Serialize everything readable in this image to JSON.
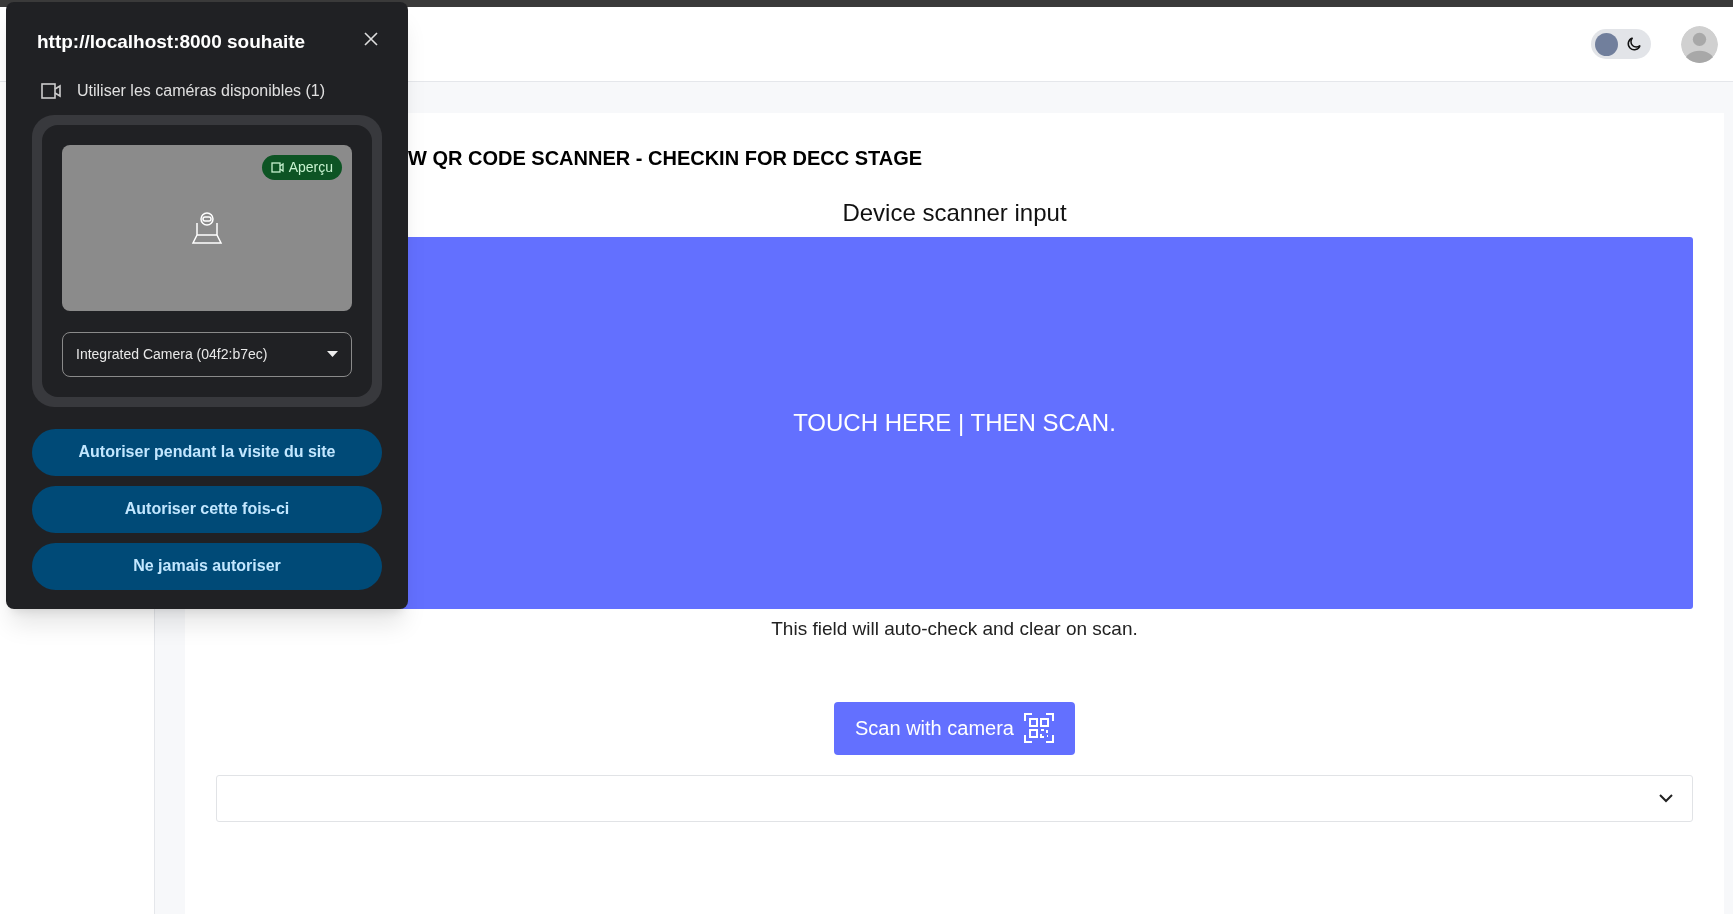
{
  "header": {
    "dark_mode": false
  },
  "page": {
    "title": "W QR CODE SCANNER - CHECKIN FOR DECC STAGE",
    "scanner_label": "Device scanner input",
    "scan_area_text": "TOUCH HERE | THEN SCAN.",
    "hint": "This field will auto-check and clear on scan.",
    "scan_button": "Scan with camera"
  },
  "popup": {
    "title": "http://localhost:8000 souhaite",
    "permission": "Utiliser les caméras disponibles (1)",
    "preview_badge": "Aperçu",
    "camera_select": {
      "value": "Integrated Camera (04f2:b7ec)"
    },
    "buttons": [
      "Autoriser pendant la visite du site",
      "Autoriser cette fois-ci",
      "Ne jamais autoriser"
    ]
  }
}
